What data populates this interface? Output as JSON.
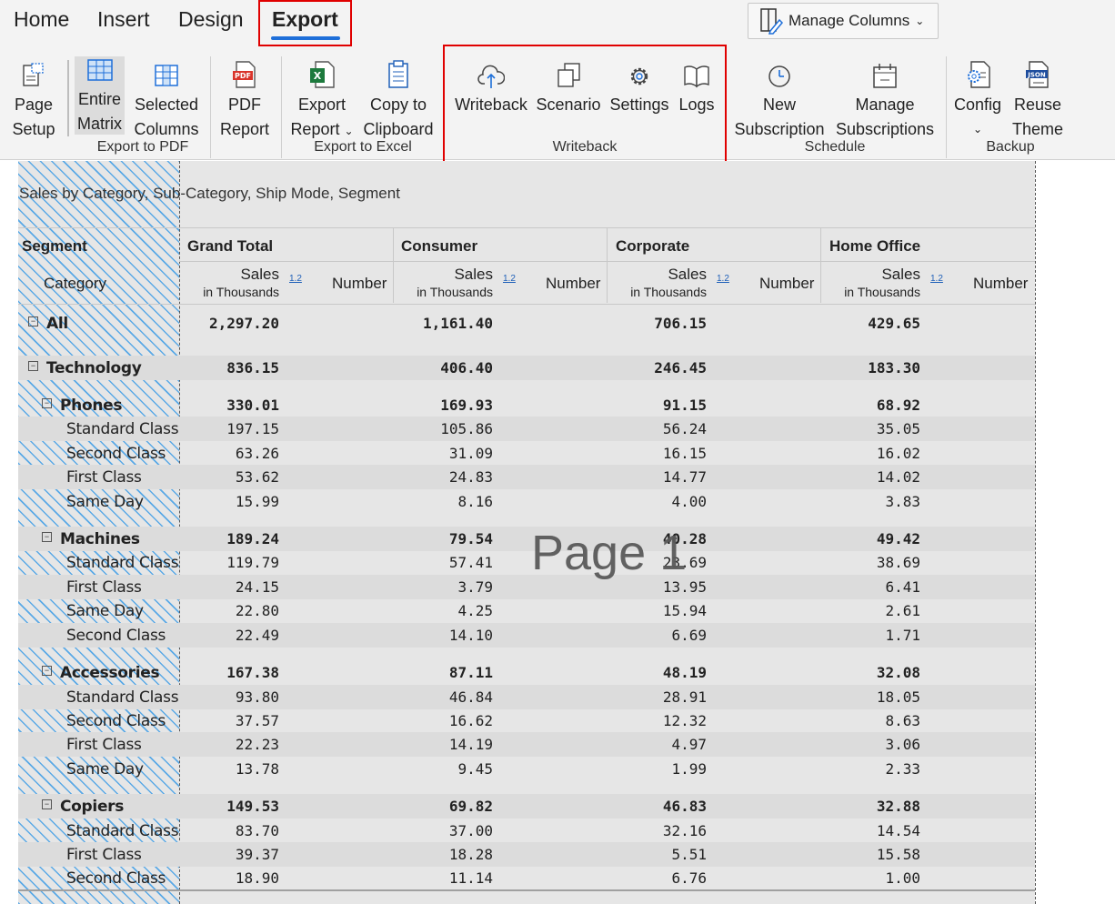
{
  "tabs": [
    {
      "label": "Home"
    },
    {
      "label": "Insert"
    },
    {
      "label": "Design"
    },
    {
      "label": "Export"
    }
  ],
  "manage_columns": {
    "label": "Manage Columns"
  },
  "ribbon": {
    "page_setup": {
      "line1": "Page",
      "line2": "Setup"
    },
    "entire_matrix": {
      "line1": "Entire",
      "line2": "Matrix"
    },
    "selected_columns": {
      "line1": "Selected",
      "line2": "Columns"
    },
    "pdf_report": {
      "line1": "PDF",
      "line2": "Report"
    },
    "export_report": {
      "line1": "Export",
      "line2": "Report"
    },
    "copy_clipboard": {
      "line1": "Copy to",
      "line2": "Clipboard"
    },
    "writeback": {
      "label": "Writeback"
    },
    "scenario": {
      "label": "Scenario"
    },
    "settings": {
      "label": "Settings"
    },
    "logs": {
      "label": "Logs"
    },
    "new_subscription": {
      "line1": "New",
      "line2": "Subscription"
    },
    "manage_subscriptions": {
      "line1": "Manage",
      "line2": "Subscriptions"
    },
    "config": {
      "label": "Config"
    },
    "reuse_theme": {
      "line1": "Reuse",
      "line2": "Theme"
    },
    "groups": {
      "export_pdf": "Export to PDF",
      "export_excel": "Export to Excel",
      "writeback": "Writeback",
      "schedule": "Schedule",
      "backup": "Backup"
    },
    "pdf_badge": "PDF",
    "json_badge": "JSON",
    "excel_badge": "X"
  },
  "report": {
    "title": "Sales by Category, Sub-Category, Ship Mode, Segment",
    "segment_header": "Segment",
    "category_header": "Category",
    "columns": [
      "Grand Total",
      "Consumer",
      "Corporate",
      "Home Office"
    ],
    "sales_label": "Sales",
    "sales_unit": "in Thousands",
    "format_link": "1.2",
    "number_label": "Number",
    "watermark": "Page 1",
    "rows": [
      {
        "label": "All",
        "values": [
          "2,297.20",
          "1,161.40",
          "706.15",
          "429.65"
        ]
      },
      {
        "label": "Technology",
        "values": [
          "836.15",
          "406.40",
          "246.45",
          "183.30"
        ]
      },
      {
        "label": "Phones",
        "values": [
          "330.01",
          "169.93",
          "91.15",
          "68.92"
        ]
      },
      {
        "label": "Standard Class",
        "values": [
          "197.15",
          "105.86",
          "56.24",
          "35.05"
        ]
      },
      {
        "label": "Second Class",
        "values": [
          "63.26",
          "31.09",
          "16.15",
          "16.02"
        ]
      },
      {
        "label": "First Class",
        "values": [
          "53.62",
          "24.83",
          "14.77",
          "14.02"
        ]
      },
      {
        "label": "Same Day",
        "values": [
          "15.99",
          "8.16",
          "4.00",
          "3.83"
        ]
      },
      {
        "label": "Machines",
        "values": [
          "189.24",
          "79.54",
          "40.28",
          "49.42"
        ]
      },
      {
        "label": "Standard Class",
        "values": [
          "119.79",
          "57.41",
          "23.69",
          "38.69"
        ]
      },
      {
        "label": "First Class",
        "values": [
          "24.15",
          "3.79",
          "13.95",
          "6.41"
        ]
      },
      {
        "label": "Same Day",
        "values": [
          "22.80",
          "4.25",
          "15.94",
          "2.61"
        ]
      },
      {
        "label": "Second Class",
        "values": [
          "22.49",
          "14.10",
          "6.69",
          "1.71"
        ]
      },
      {
        "label": "Accessories",
        "values": [
          "167.38",
          "87.11",
          "48.19",
          "32.08"
        ]
      },
      {
        "label": "Standard Class",
        "values": [
          "93.80",
          "46.84",
          "28.91",
          "18.05"
        ]
      },
      {
        "label": "Second Class",
        "values": [
          "37.57",
          "16.62",
          "12.32",
          "8.63"
        ]
      },
      {
        "label": "First Class",
        "values": [
          "22.23",
          "14.19",
          "4.97",
          "3.06"
        ]
      },
      {
        "label": "Same Day",
        "values": [
          "13.78",
          "9.45",
          "1.99",
          "2.33"
        ]
      },
      {
        "label": "Copiers",
        "values": [
          "149.53",
          "69.82",
          "46.83",
          "32.88"
        ]
      },
      {
        "label": "Standard Class",
        "values": [
          "83.70",
          "37.00",
          "32.16",
          "14.54"
        ]
      },
      {
        "label": "First Class",
        "values": [
          "39.37",
          "18.28",
          "5.51",
          "15.58"
        ]
      },
      {
        "label": "Second Class",
        "values": [
          "18.90",
          "11.14",
          "6.76",
          "1.00"
        ]
      }
    ]
  },
  "colors": {
    "accent": "#1e6fd9",
    "highlight_box": "#e00000",
    "hatch": "#5aa9e6"
  }
}
